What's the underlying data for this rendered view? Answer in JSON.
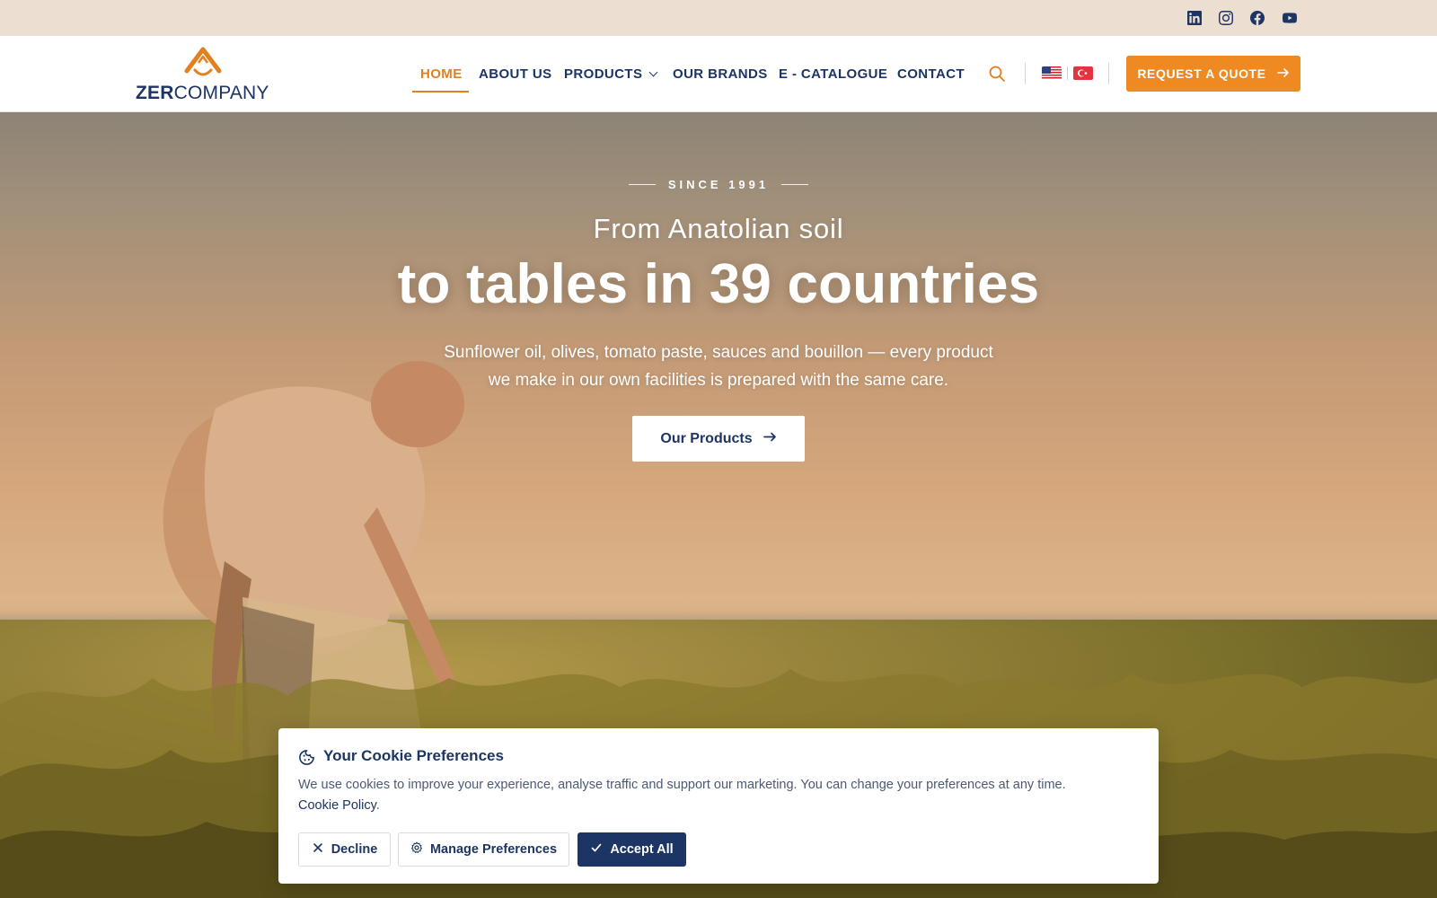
{
  "topbar": {
    "social": [
      {
        "icon": "linkedin-icon",
        "label": "LinkedIn"
      },
      {
        "icon": "instagram-icon",
        "label": "Instagram"
      },
      {
        "icon": "facebook-icon",
        "label": "Facebook"
      },
      {
        "icon": "youtube-icon",
        "label": "YouTube"
      }
    ]
  },
  "brand": {
    "name_bold": "ZER",
    "name_light": "COMPANY",
    "logo_icon": "mountain-logo-icon"
  },
  "nav": {
    "items": [
      {
        "label": "HOME",
        "active": true
      },
      {
        "label": "ABOUT US",
        "active": false
      },
      {
        "label": "PRODUCTS",
        "active": false,
        "has_dropdown": true
      },
      {
        "label": "OUR BRANDS",
        "active": false
      },
      {
        "label": "E - CATALOGUE",
        "active": false
      },
      {
        "label": "CONTACT",
        "active": false
      }
    ],
    "search_icon": "search-icon",
    "languages": [
      {
        "code": "en",
        "icon": "us-flag-icon"
      },
      {
        "code": "tr",
        "icon": "turkey-flag-icon"
      }
    ],
    "cta_label": "REQUEST A QUOTE"
  },
  "hero": {
    "eyebrow": "SINCE 1991",
    "pre_title": "From Anatolian soil",
    "title": "to tables in 39 countries",
    "subtitle_line1": "Sunflower oil, olives, tomato paste, sauces and bouillon — every product",
    "subtitle_line2": "we make in our own facilities is prepared with the same care.",
    "button_label": "Our Products"
  },
  "cookie": {
    "icon": "cookie-icon",
    "title": "Your Cookie Preferences",
    "text": "We use cookies to improve your experience, analyse traffic and support our marketing. You can change your preferences at any time.",
    "link_label": "Cookie Policy",
    "link_suffix": ".",
    "decline_label": "Decline",
    "manage_label": "Manage Preferences",
    "accept_label": "Accept All"
  },
  "colors": {
    "navy": "#1c3564",
    "orange": "#e0801f",
    "cta_orange": "#ef8a22",
    "topbar_bg": "#ecdfd2"
  }
}
